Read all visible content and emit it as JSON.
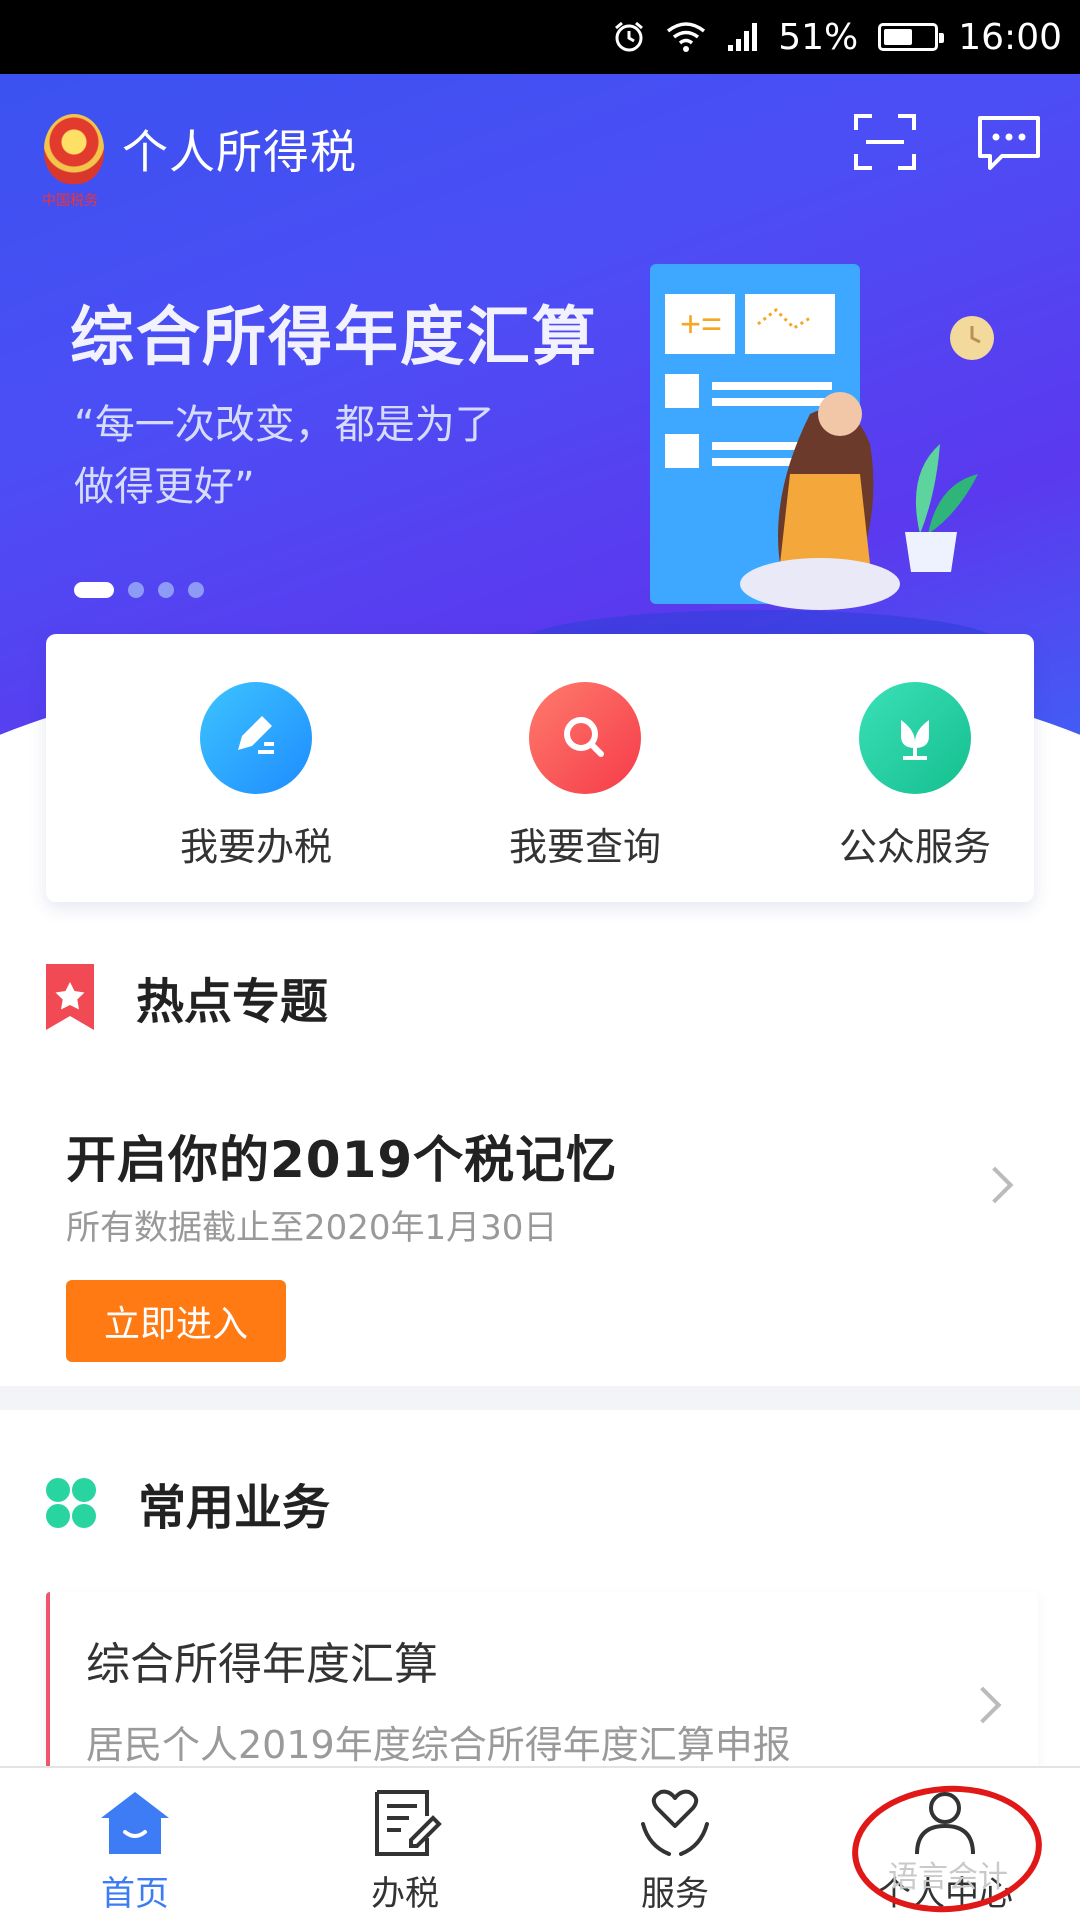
{
  "status_bar": {
    "battery": "51%",
    "time": "16:00"
  },
  "header": {
    "app_title": "个人所得税",
    "emblem_text": "中国税务"
  },
  "banner": {
    "title": "综合所得年度汇算",
    "quote": "“每一次改变，都是为了做得更好”",
    "slides_total": 4,
    "active_slide": 1
  },
  "quick_actions": [
    {
      "label": "我要办税",
      "icon": "edit-icon",
      "color": "#21a7ff"
    },
    {
      "label": "我要查询",
      "icon": "search-icon",
      "color": "#ff5a56"
    },
    {
      "label": "公众服务",
      "icon": "tulip-icon",
      "color": "#1fd1a5"
    }
  ],
  "hot_topics": {
    "title": "热点专题",
    "item_title": "开启你的2019个税记忆",
    "item_sub": "所有数据截止至2020年1月30日",
    "button": "立即进入"
  },
  "common_business": {
    "title": "常用业务",
    "items": [
      {
        "title": "综合所得年度汇算",
        "sub": "居民个人2019年度综合所得年度汇算申报"
      }
    ]
  },
  "tabbar": {
    "tabs": [
      {
        "label": "首页",
        "icon": "home-icon",
        "active": true
      },
      {
        "label": "办税",
        "icon": "document-edit-icon",
        "active": false
      },
      {
        "label": "服务",
        "icon": "heart-hands-icon",
        "active": false
      },
      {
        "label": "个人中心",
        "icon": "person-icon",
        "active": false
      }
    ]
  },
  "watermark": "语言会计",
  "colors": {
    "accent": "#3d7cf5",
    "orange": "#ff7a12",
    "red_marker": "#e01818"
  }
}
